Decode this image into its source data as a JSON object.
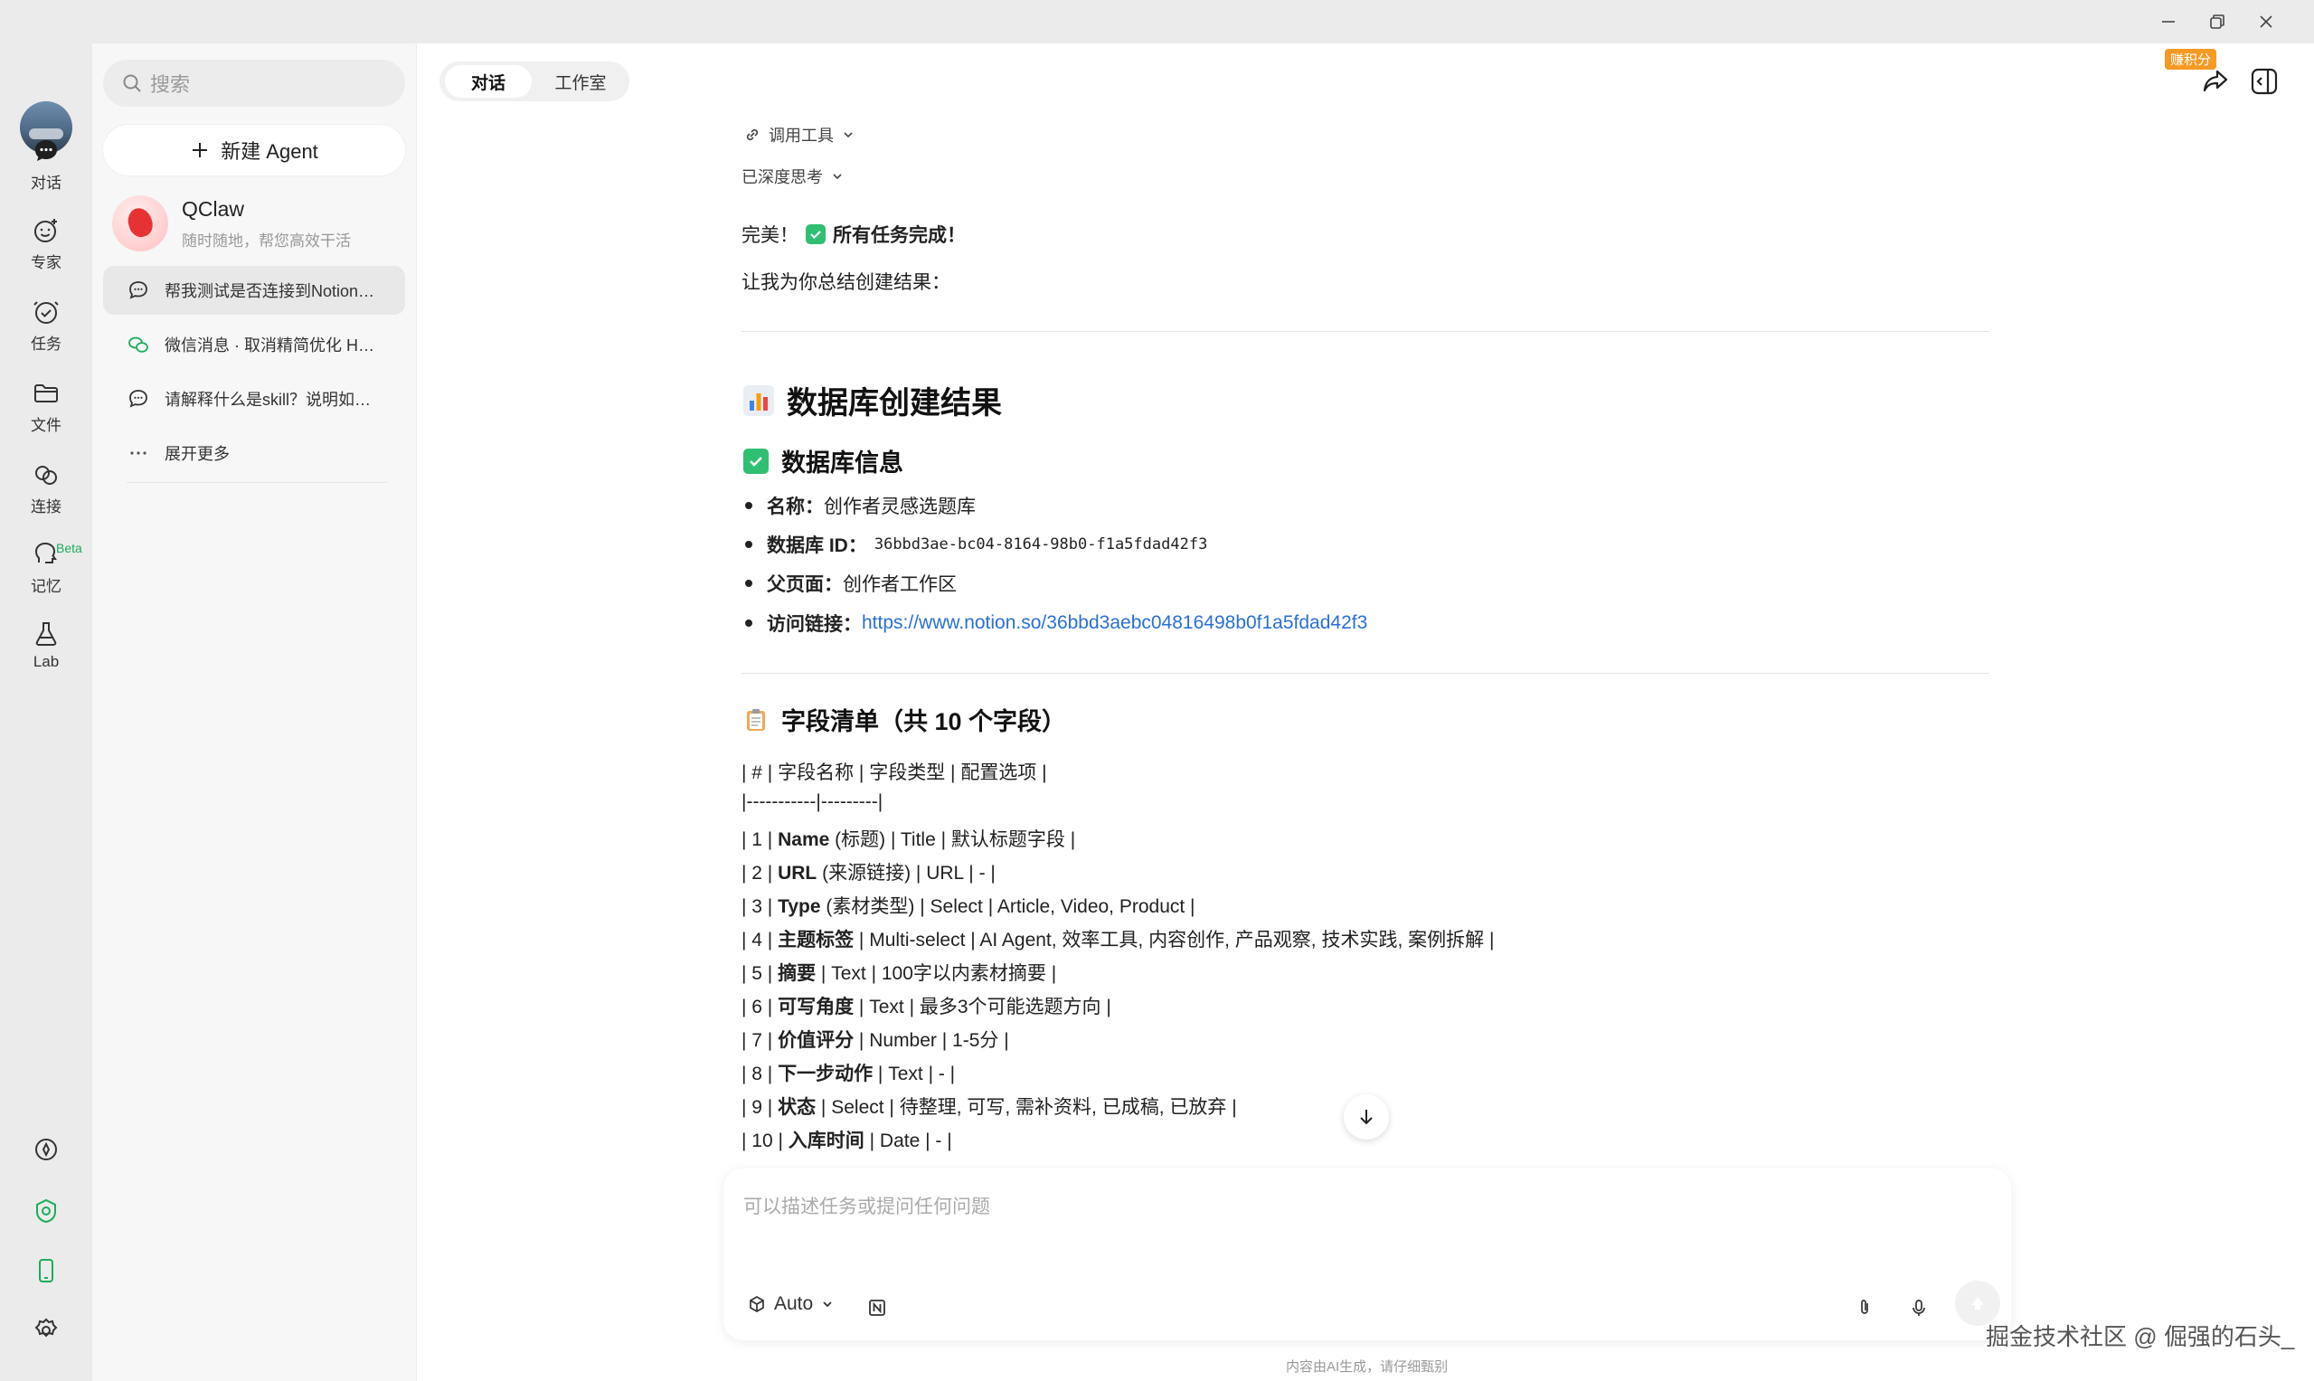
{
  "window": {
    "minimize": "—",
    "restore": "❐",
    "close": "✕"
  },
  "rail": {
    "items": [
      {
        "label": "对话",
        "icon": "chat-bubble-icon"
      },
      {
        "label": "专家",
        "icon": "expert-icon"
      },
      {
        "label": "任务",
        "icon": "clock-check-icon"
      },
      {
        "label": "文件",
        "icon": "folder-icon"
      },
      {
        "label": "连接",
        "icon": "link-icon"
      },
      {
        "label": "记忆",
        "icon": "memory-icon"
      },
      {
        "label": "Lab",
        "icon": "flask-icon"
      }
    ],
    "beta": "Beta",
    "bottom_icons": [
      "compass-icon",
      "credit-icon",
      "phone-icon",
      "gear-icon"
    ]
  },
  "sidebar": {
    "search_placeholder": "搜索",
    "new_agent": "新建 Agent",
    "agent": {
      "name": "QClaw",
      "subtitle": "随时随地，帮您高效干活"
    },
    "history": [
      {
        "text": "帮我测试是否连接到Notion，并创建选题库",
        "icon": "chat-icon",
        "active": true
      },
      {
        "text": "微信消息 · 取消精简优化 HEARTBEAT",
        "icon": "wechat-icon",
        "active": false
      },
      {
        "text": "请解释什么是skill？说明如何使用",
        "icon": "chat-icon",
        "active": false
      },
      {
        "text": "展开更多",
        "icon": "more-icon",
        "active": false
      }
    ]
  },
  "tabs": [
    {
      "label": "对话",
      "active": true
    },
    {
      "label": "工作室",
      "active": false
    }
  ],
  "header": {
    "badge": "赚积分"
  },
  "chat": {
    "tool_call": "调用工具",
    "thinking": "已深度思考",
    "done_prefix": "完美！",
    "done_text": "所有任务完成！",
    "summary_intro": "让我为你总结创建结果：",
    "h1": "数据库创建结果",
    "h2_info": "数据库信息",
    "info": [
      {
        "label": "名称：",
        "value": "创作者灵感选题库",
        "type": "text"
      },
      {
        "label": "数据库 ID：",
        "value": "36bbd3ae-bc04-8164-98b0-f1a5fdad42f3",
        "type": "mono"
      },
      {
        "label": "父页面：",
        "value": "创作者工作区",
        "type": "text"
      },
      {
        "label": "访问链接：",
        "value": "https://www.notion.so/36bbd3aebc04816498b0f1a5fdad42f3",
        "type": "link"
      }
    ],
    "h2_fields": "字段清单（共 10 个字段）",
    "table_header": "| # | 字段名称 | 字段类型 | 配置选项 |",
    "table_sep": "|-----------|---------|",
    "rows": [
      {
        "pre": "| 1 | ",
        "name": "Name",
        "post": " (标题) | Title | 默认标题字段 |"
      },
      {
        "pre": "| 2 | ",
        "name": "URL",
        "post": " (来源链接) | URL | - |"
      },
      {
        "pre": "| 3 | ",
        "name": "Type",
        "post": " (素材类型) | Select | Article, Video, Product |"
      },
      {
        "pre": "| 4 | ",
        "name": "主题标签",
        "post": " | Multi-select | AI Agent, 效率工具, 内容创作, 产品观察, 技术实践, 案例拆解 |"
      },
      {
        "pre": "| 5 | ",
        "name": "摘要",
        "post": " | Text | 100字以内素材摘要 |"
      },
      {
        "pre": "| 6 | ",
        "name": "可写角度",
        "post": " | Text | 最多3个可能选题方向 |"
      },
      {
        "pre": "| 7 | ",
        "name": "价值评分",
        "post": " | Number | 1-5分 |"
      },
      {
        "pre": "| 8 | ",
        "name": "下一步动作",
        "post": " | Text | - |"
      },
      {
        "pre": "| 9 | ",
        "name": "状态",
        "post": " | Select | 待整理, 可写, 需补资料, 已成稿, 已放弃 |"
      },
      {
        "pre": "| 10 | ",
        "name": "入库时间",
        "post": " | Date | - |"
      }
    ]
  },
  "input": {
    "placeholder": "可以描述任务或提问任何问题",
    "model": "Auto"
  },
  "disclaimer": "内容由AI生成，请仔细甄别",
  "watermark": "掘金技术社区 @ 倔强的石头_",
  "colors": {
    "accent_green": "#1aad5a",
    "link": "#2a6fd6",
    "badge": "#f59a23"
  }
}
